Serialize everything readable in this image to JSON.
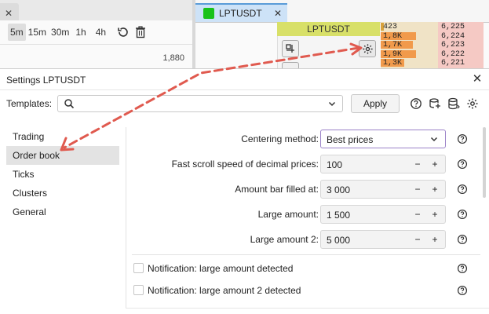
{
  "chart": {
    "timeframes": [
      "5m",
      "15m",
      "30m",
      "1h",
      "4h"
    ],
    "active_timeframe": "5m",
    "price_label": "1,880",
    "tab_close": "✕"
  },
  "instrument_tab": {
    "name": "LPTUSDT",
    "close": "✕",
    "status_color": "#19c219"
  },
  "orderbook": {
    "title": "LPTUSDT",
    "volumes": [
      "423",
      "1,8K",
      "1,7K",
      "1,9K",
      "1,3K"
    ],
    "volume_fill": [
      0.05,
      0.62,
      0.56,
      0.62,
      0.41
    ],
    "prices": [
      "6,225",
      "6,224",
      "6,223",
      "6,222",
      "6,221"
    ]
  },
  "settings": {
    "title": "Settings LPTUSDT",
    "close": "✕",
    "templates_label": "Templates:",
    "templates_placeholder": "",
    "apply_label": "Apply",
    "nav": [
      "Trading",
      "Order book",
      "Ticks",
      "Clusters",
      "General"
    ],
    "active_nav": "Order book",
    "rows": [
      {
        "label": "Centering method:",
        "value": "Best prices",
        "kind": "select"
      },
      {
        "label": "Fast scroll speed of decimal prices:",
        "value": "100",
        "kind": "number"
      },
      {
        "label": "Amount bar filled at:",
        "value": "3 000",
        "kind": "number"
      },
      {
        "label": "Large amount:",
        "value": "1 500",
        "kind": "number"
      },
      {
        "label": "Large amount 2:",
        "value": "5 000",
        "kind": "number"
      }
    ],
    "checks": [
      {
        "label": "Notification: large amount detected",
        "checked": false
      },
      {
        "label": "Notification: large amount 2 detected",
        "checked": false
      }
    ],
    "step_minus": "−",
    "step_plus": "+"
  },
  "colors": {
    "accent_arrow": "#e05a4f",
    "select_border": "#9b82c8",
    "tab_bg": "#cde2f7"
  }
}
